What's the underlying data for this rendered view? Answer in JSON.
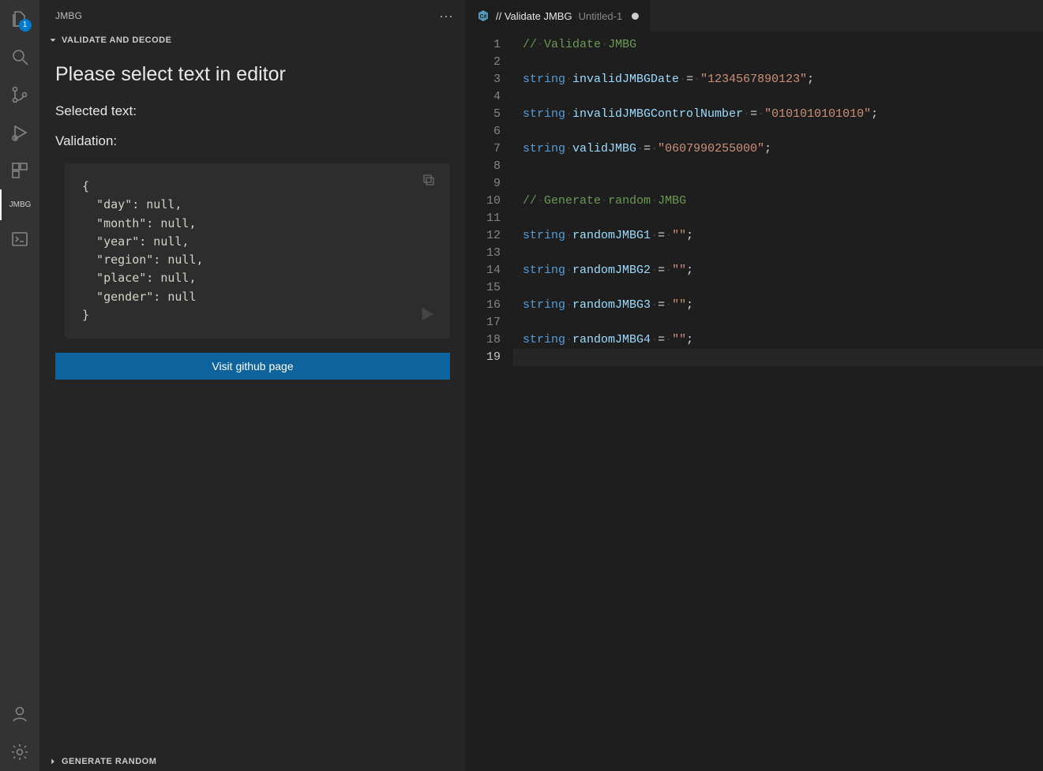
{
  "activitybar": {
    "items": [
      {
        "id": "explorer",
        "name": "explorer-icon",
        "badge": "1"
      },
      {
        "id": "search",
        "name": "search-icon"
      },
      {
        "id": "scm",
        "name": "source-control-icon"
      },
      {
        "id": "debug",
        "name": "run-debug-icon"
      },
      {
        "id": "extensions",
        "name": "extensions-icon"
      },
      {
        "id": "jmbg",
        "name": "jmbg-view",
        "label": "JMBG",
        "active": true
      },
      {
        "id": "terminal",
        "name": "terminal-icon"
      }
    ],
    "bottom": [
      {
        "id": "account",
        "name": "account-icon"
      },
      {
        "id": "settings",
        "name": "gear-icon"
      }
    ]
  },
  "sidepanel": {
    "title": "JMBG",
    "sections": {
      "validate_decode": {
        "heading": "VALIDATE AND DECODE",
        "open": true,
        "headline": "Please select text in editor",
        "selected_label": "Selected text:",
        "validation_label": "Validation:",
        "json_block": "{\n  \"day\": null,\n  \"month\": null,\n  \"year\": null,\n  \"region\": null,\n  \"place\": null,\n  \"gender\": null\n}",
        "visit_button": "Visit github page"
      },
      "generate_random": {
        "heading": "GENERATE RANDOM",
        "open": false
      }
    }
  },
  "editor": {
    "tab": {
      "prefix": "// Validate JMBG",
      "suffix": "Untitled-1",
      "language": "csharp",
      "dirty": true
    },
    "lines": [
      {
        "type": "comment",
        "text": "// Validate JMBG"
      },
      {
        "type": "blank"
      },
      {
        "type": "decl",
        "keyword": "string",
        "name": "invalidJMBGDate",
        "value": "\"1234567890123\""
      },
      {
        "type": "blank"
      },
      {
        "type": "decl",
        "keyword": "string",
        "name": "invalidJMBGControlNumber",
        "value": "\"0101010101010\""
      },
      {
        "type": "blank"
      },
      {
        "type": "decl",
        "keyword": "string",
        "name": "validJMBG",
        "value": "\"0607990255000\""
      },
      {
        "type": "blank"
      },
      {
        "type": "blank"
      },
      {
        "type": "comment",
        "text": "// Generate random JMBG"
      },
      {
        "type": "blank"
      },
      {
        "type": "decl",
        "keyword": "string",
        "name": "randomJMBG1",
        "value": "\"\""
      },
      {
        "type": "blank"
      },
      {
        "type": "decl",
        "keyword": "string",
        "name": "randomJMBG2",
        "value": "\"\""
      },
      {
        "type": "blank"
      },
      {
        "type": "decl",
        "keyword": "string",
        "name": "randomJMBG3",
        "value": "\"\""
      },
      {
        "type": "blank"
      },
      {
        "type": "decl",
        "keyword": "string",
        "name": "randomJMBG4",
        "value": "\"\""
      },
      {
        "type": "blank"
      }
    ],
    "current_line": 19
  }
}
